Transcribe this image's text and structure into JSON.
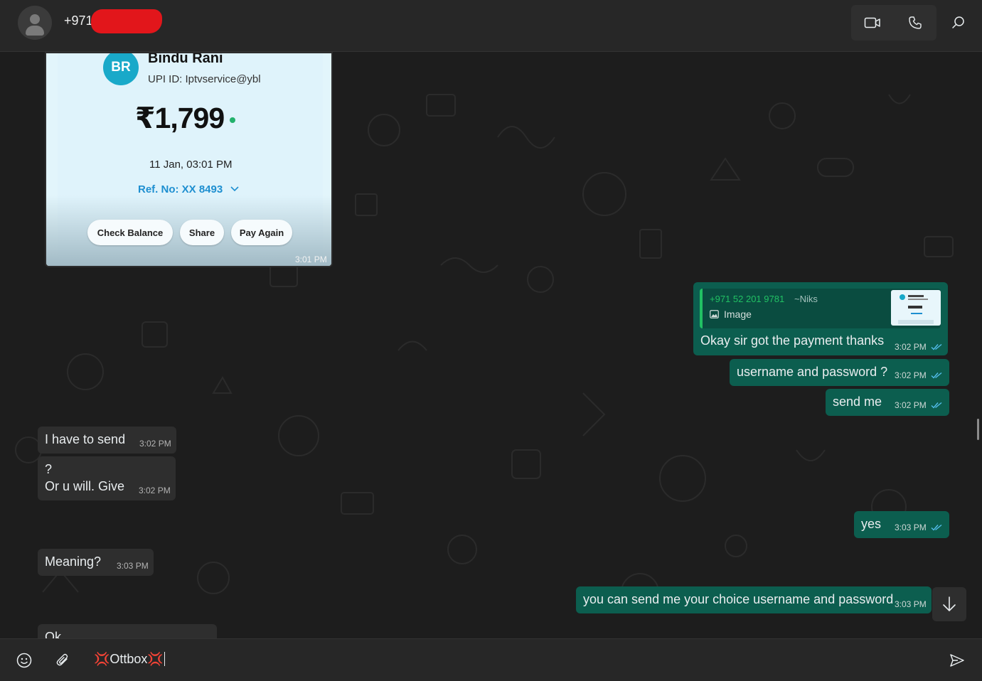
{
  "header": {
    "contact_name": "+971",
    "video_icon": "video-call-icon",
    "voice_icon": "phone-icon",
    "search_icon": "search-icon"
  },
  "image_message": {
    "avatar_initials": "BR",
    "payee_name": "Bindu Rani",
    "upi_id": "UPI ID: Iptvservice@ybl",
    "amount": "₹1,799",
    "date": "11 Jan, 03:01 PM",
    "ref_no": "Ref. No: XX 8493",
    "buttons": [
      "Check Balance",
      "Share",
      "Pay Again"
    ],
    "time": "3:01 PM"
  },
  "reply_message": {
    "quoted_phone": "+971 52 201 9781",
    "quoted_alias": "~Niks",
    "quoted_type": "Image",
    "text": "Okay sir got the payment thanks",
    "time": "3:02 PM"
  },
  "messages": [
    {
      "dir": "out",
      "text": "username and password ?",
      "time": "3:02 PM"
    },
    {
      "dir": "out",
      "text": "send me",
      "time": "3:02 PM"
    },
    {
      "dir": "in",
      "text": "I have to send",
      "time": "3:02 PM"
    },
    {
      "dir": "in",
      "text": "?",
      "text2": "Or u will. Give",
      "time": "3:02 PM"
    },
    {
      "dir": "out",
      "text": "yes",
      "time": "3:03 PM"
    },
    {
      "dir": "in",
      "text": "Meaning?",
      "time": "3:03 PM"
    },
    {
      "dir": "out",
      "text": "you can send me your choice username and password",
      "time": "3:03 PM"
    },
    {
      "dir": "in",
      "text": "Ok",
      "time": ""
    }
  ],
  "composer": {
    "input_value": "💢Ottbox💢",
    "emoji_icon": "emoji-icon",
    "attach_icon": "paperclip-icon",
    "send_icon": "send-icon"
  },
  "colors": {
    "outgoing_bubble": "#0c5e4f",
    "incoming_bubble": "#2e2e2e",
    "accent_green": "#21c063",
    "read_tick": "#53bdeb"
  }
}
